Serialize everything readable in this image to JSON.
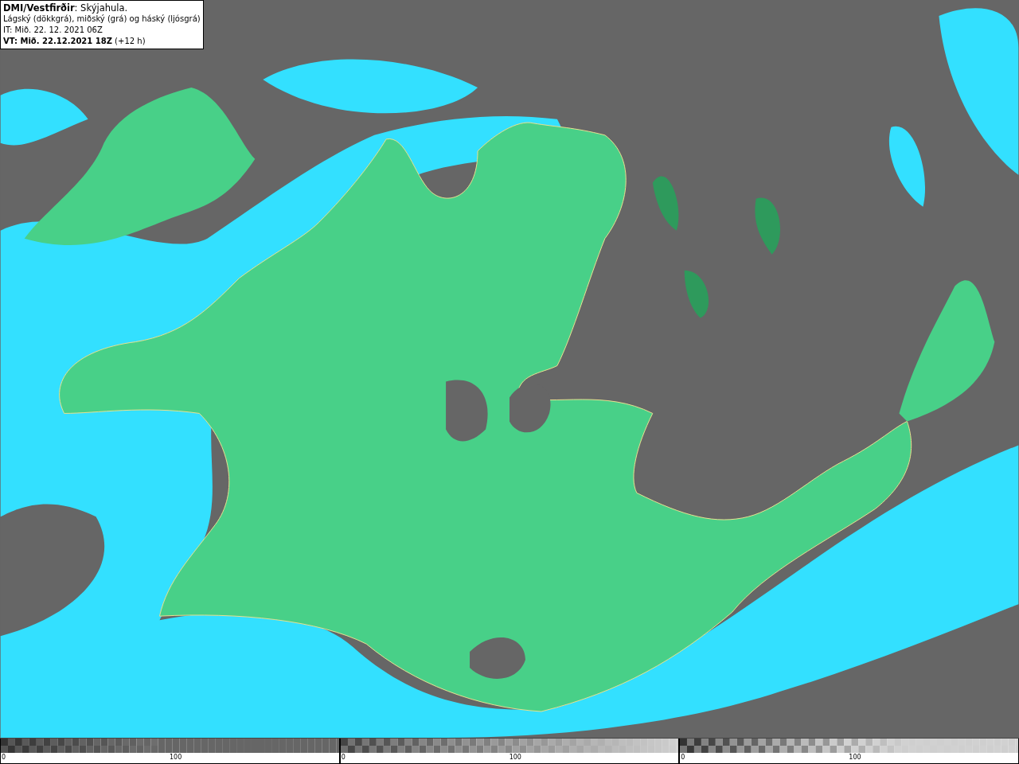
{
  "legend": {
    "lines": [
      "**DMI/Vestfirðir**: Skýjahula.",
      "Lágský (dökkgrá), miðský (grá) og háský (ljósgrá)",
      "IT: Mið. 22. 12. 2021 06Z",
      "**VT: Mið. 22.12.2021 18Z** (+12 h)"
    ]
  },
  "scales": [
    {
      "kind": "low",
      "min_label": "0",
      "mid_label": "100"
    },
    {
      "kind": "mid",
      "min_label": "0",
      "mid_label": "100"
    },
    {
      "kind": "high",
      "min_label": "0",
      "mid_label": "100"
    }
  ]
}
